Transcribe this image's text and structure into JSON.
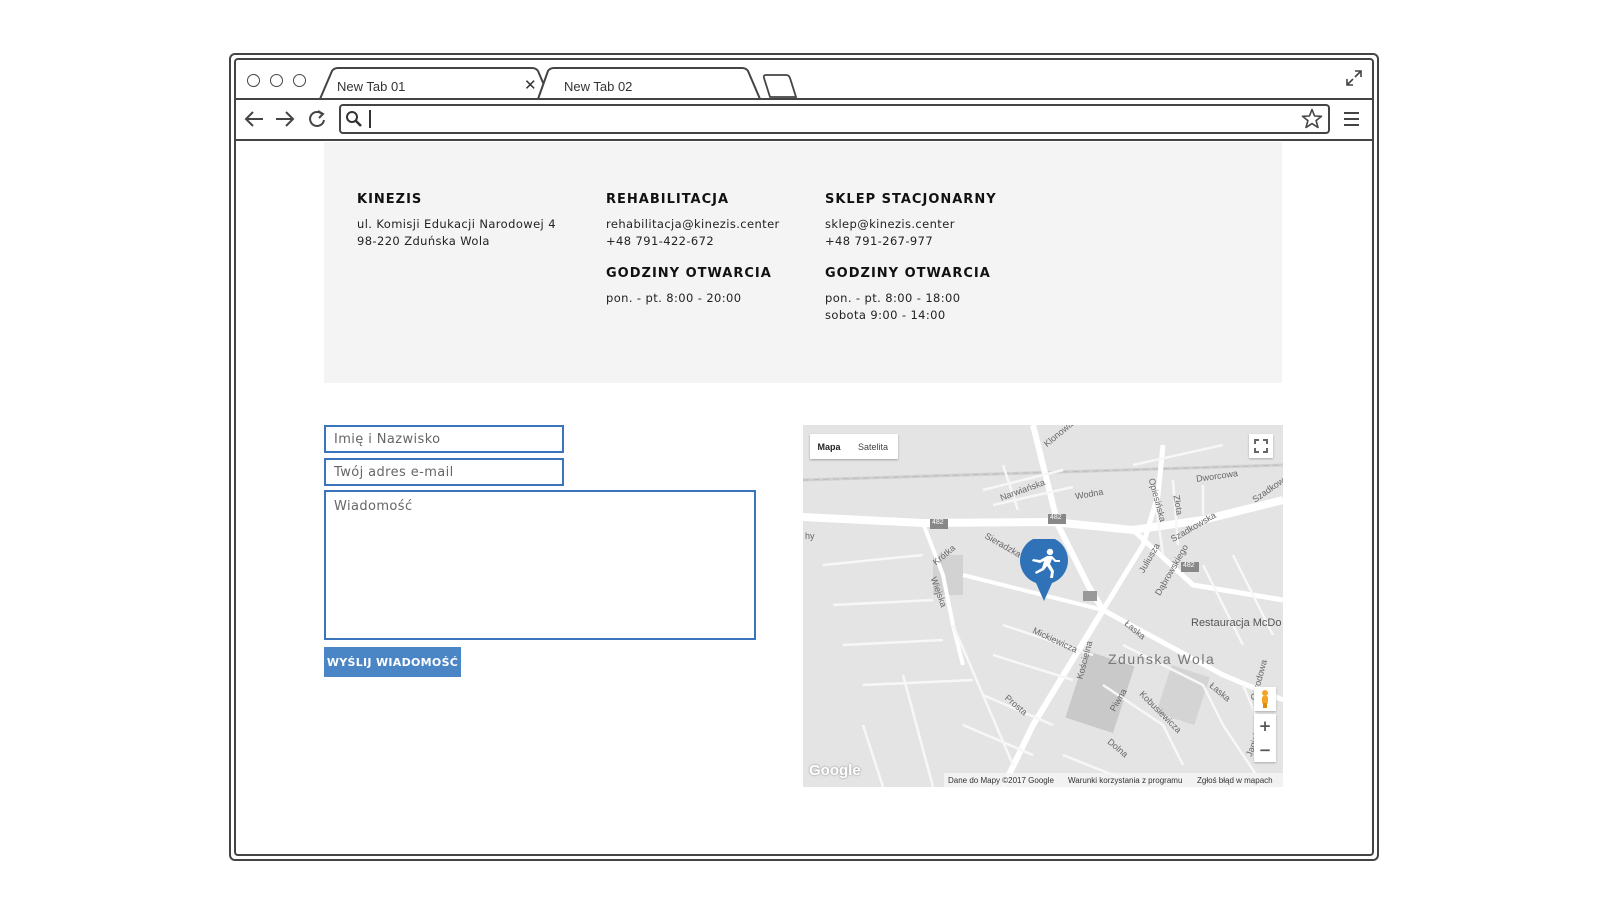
{
  "browser": {
    "tabs": [
      {
        "label": "New Tab 01"
      },
      {
        "label": "New Tab 02"
      }
    ],
    "url": ""
  },
  "info": {
    "col1": {
      "title": "KINEZIS",
      "line1": "ul. Komisji Edukacji Narodowej 4",
      "line2": "98-220 Zduńska Wola"
    },
    "col2": {
      "title": "REHABILITACJA",
      "email": "rehabilitacja@kinezis.center",
      "phone": "+48 791-422-672",
      "hours_title": "GODZINY OTWARCIA",
      "hours1": "pon. - pt. 8:00 - 20:00"
    },
    "col3": {
      "title": "SKLEP STACJONARNY",
      "email": "sklep@kinezis.center",
      "phone": "+48 791-267-977",
      "hours_title": "GODZINY OTWARCIA",
      "hours1": "pon. - pt. 8:00 - 18:00",
      "hours2": "sobota 9:00 - 14:00"
    }
  },
  "form": {
    "name_placeholder": "Imię i Nazwisko",
    "email_placeholder": "Twój adres e-mail",
    "message_placeholder": "Wiadomość",
    "submit_label": "WYŚLIJ WIADOMOŚĆ"
  },
  "map": {
    "type_map": "Mapa",
    "type_satellite": "Satelita",
    "city_label": "Zduńska Wola",
    "poi_label": "Restauracja McDo",
    "zoom_in": "+",
    "zoom_out": "−",
    "logo": "Google",
    "attrib_data": "Dane do Mapy ©2017 Google",
    "attrib_terms": "Warunki korzystania z programu",
    "attrib_report": "Zgłoś błąd w mapach",
    "road_badge": "482",
    "streets": [
      "Klonowa",
      "Narwiańska",
      "Wodna",
      "Dworcowa",
      "Opiesińska",
      "Złota",
      "Szadkowska",
      "Szadkow",
      "Krótka",
      "Sieradzka",
      "Wiejska",
      "Juliusza",
      "Dąbrowskiego",
      "Łaska",
      "Mickiewicza",
      "Kościelna",
      "Prosta",
      "Piwna",
      "Kobusiewicza",
      "Dolna",
      "Ogrodowa",
      "Jagiel",
      "hy",
      "Łaska"
    ],
    "accent_color": "#2f72b8"
  }
}
